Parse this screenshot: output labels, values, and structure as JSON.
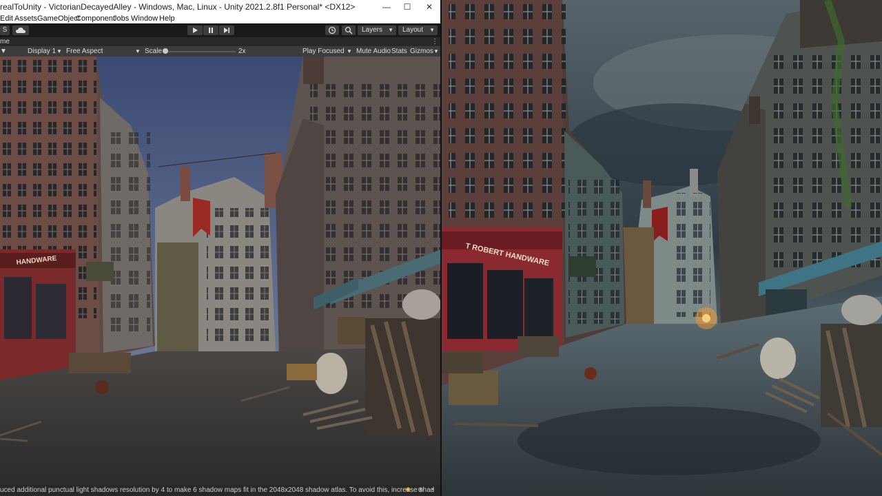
{
  "window": {
    "title": "realToUnity - VictorianDecayedAlley - Windows, Mac, Linux - Unity 2021.2.8f1 Personal* <DX12>"
  },
  "menu": [
    "Edit",
    "Assets",
    "GameObject",
    "Component",
    "Jobs",
    "Window",
    "Help"
  ],
  "toolbar": {
    "left_label": "S",
    "layers_label": "Layers",
    "layout_label": "Layout"
  },
  "tab": {
    "label": "me"
  },
  "game_view": {
    "display_label": "Display 1",
    "aspect_label": "Free Aspect",
    "scale_label": "Scale",
    "scale_value": "2x",
    "play_focused": "Play Focused",
    "mute_audio": "Mute Audio",
    "stats": "Stats",
    "gizmos": "Gizmos"
  },
  "console": {
    "message": "uced additional punctual light shadows resolution by 4 to make 6 shadow maps fit in the 2048x2048 shadow atlas. To avoid this, increase shad"
  },
  "scene_signs": {
    "unity_shop": "HANDWARE",
    "unreal_shop": "T ROBERT HANDWARE"
  },
  "colors": {
    "editor_bg": "#282828",
    "toolbar_bg": "#191919",
    "titlebar_bg": "#ffffff"
  }
}
